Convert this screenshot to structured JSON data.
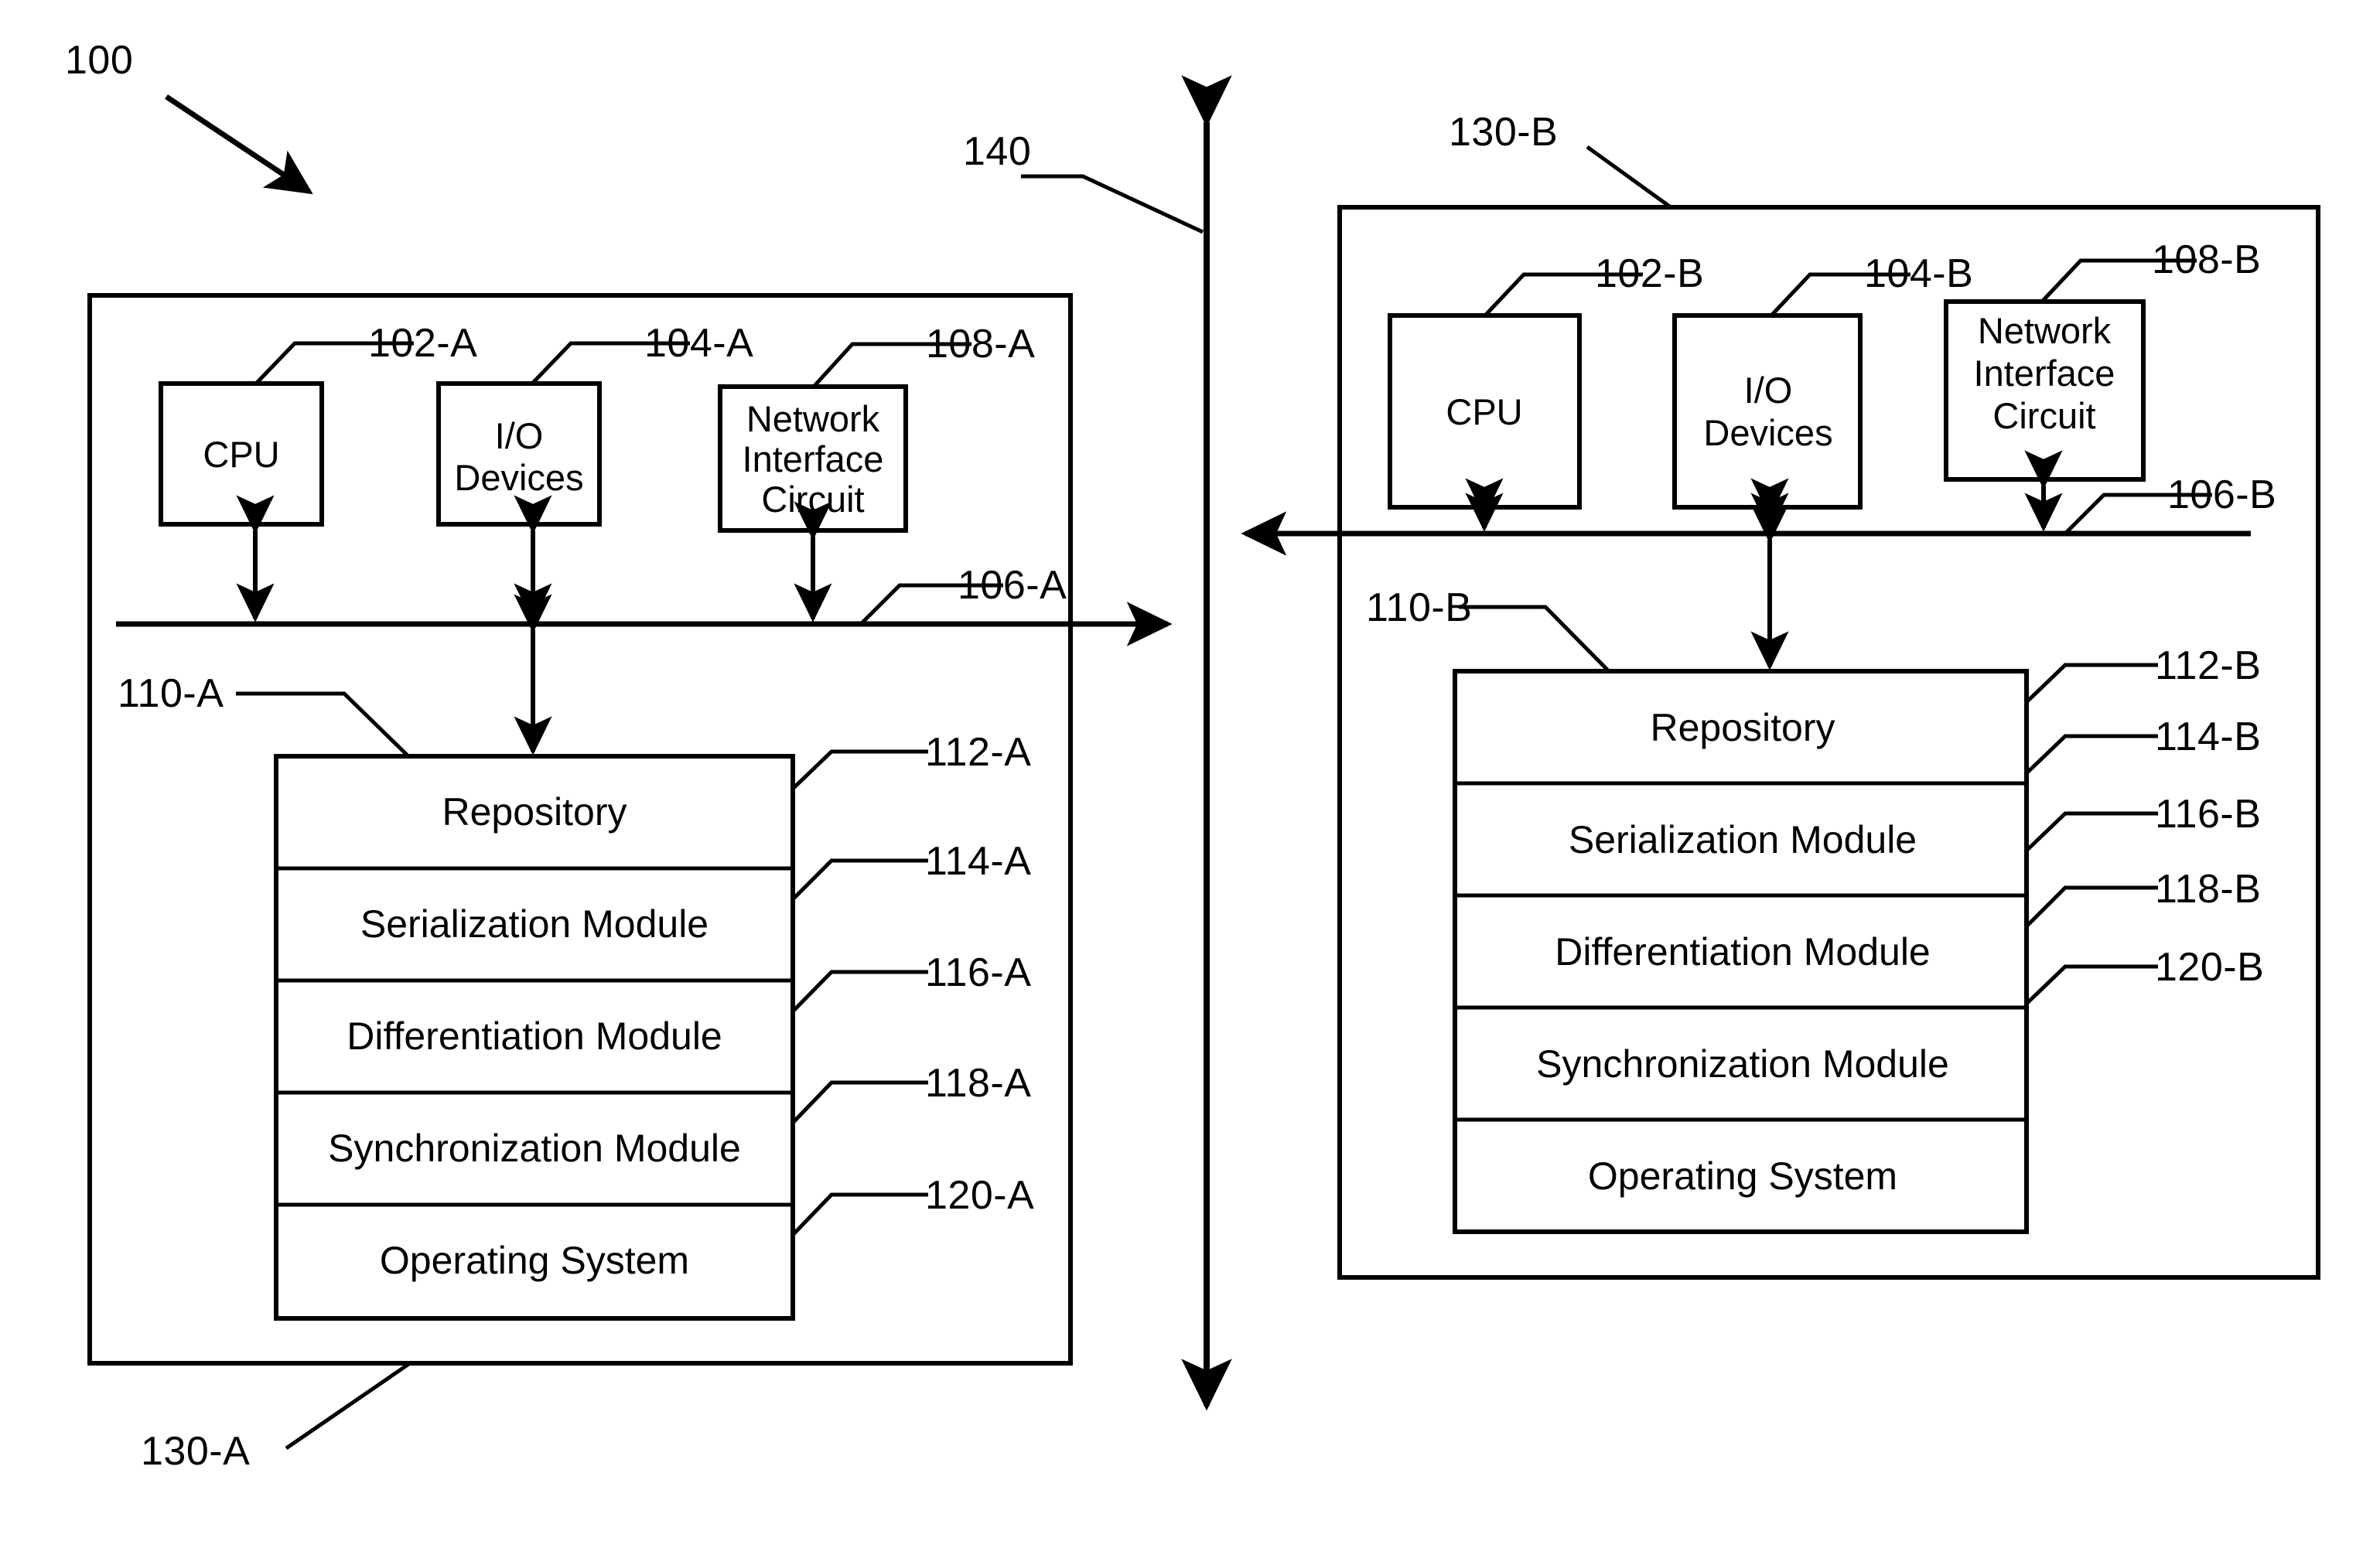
{
  "figure": {
    "system_label": "100",
    "network_label": "140"
  },
  "nodes": {
    "a": {
      "enclosure_label": "130-A",
      "cpu": {
        "label": "CPU",
        "ref": "102-A"
      },
      "io": {
        "label_line1": "I/O",
        "label_line2": "Devices",
        "ref": "104-A"
      },
      "nic": {
        "label_line1": "Network",
        "label_line2": "Interface",
        "label_line3": "Circuit",
        "ref": "108-A"
      },
      "bus_ref": "106-A",
      "memory_ref": "110-A",
      "stack": [
        {
          "label": "Repository",
          "ref": "112-A"
        },
        {
          "label": "Serialization Module",
          "ref": "114-A"
        },
        {
          "label": "Differentiation Module",
          "ref": "116-A"
        },
        {
          "label": "Synchronization Module",
          "ref": "118-A"
        },
        {
          "label": "Operating System",
          "ref": "120-A"
        }
      ]
    },
    "b": {
      "enclosure_label": "130-B",
      "cpu": {
        "label": "CPU",
        "ref": "102-B"
      },
      "io": {
        "label_line1": "I/O",
        "label_line2": "Devices",
        "ref": "104-B"
      },
      "nic": {
        "label_line1": "Network",
        "label_line2": "Interface",
        "label_line3": "Circuit",
        "ref": "108-B"
      },
      "bus_ref": "106-B",
      "memory_ref": "110-B",
      "stack": [
        {
          "label": "Repository",
          "ref": "112-B"
        },
        {
          "label": "Serialization Module",
          "ref": "114-B"
        },
        {
          "label": "Differentiation Module",
          "ref": "116-B"
        },
        {
          "label": "Synchronization Module",
          "ref": "118-B"
        },
        {
          "label": "Operating System",
          "ref": "120-B"
        }
      ]
    }
  },
  "colors": {
    "stroke": "#000000",
    "background": "#ffffff"
  }
}
